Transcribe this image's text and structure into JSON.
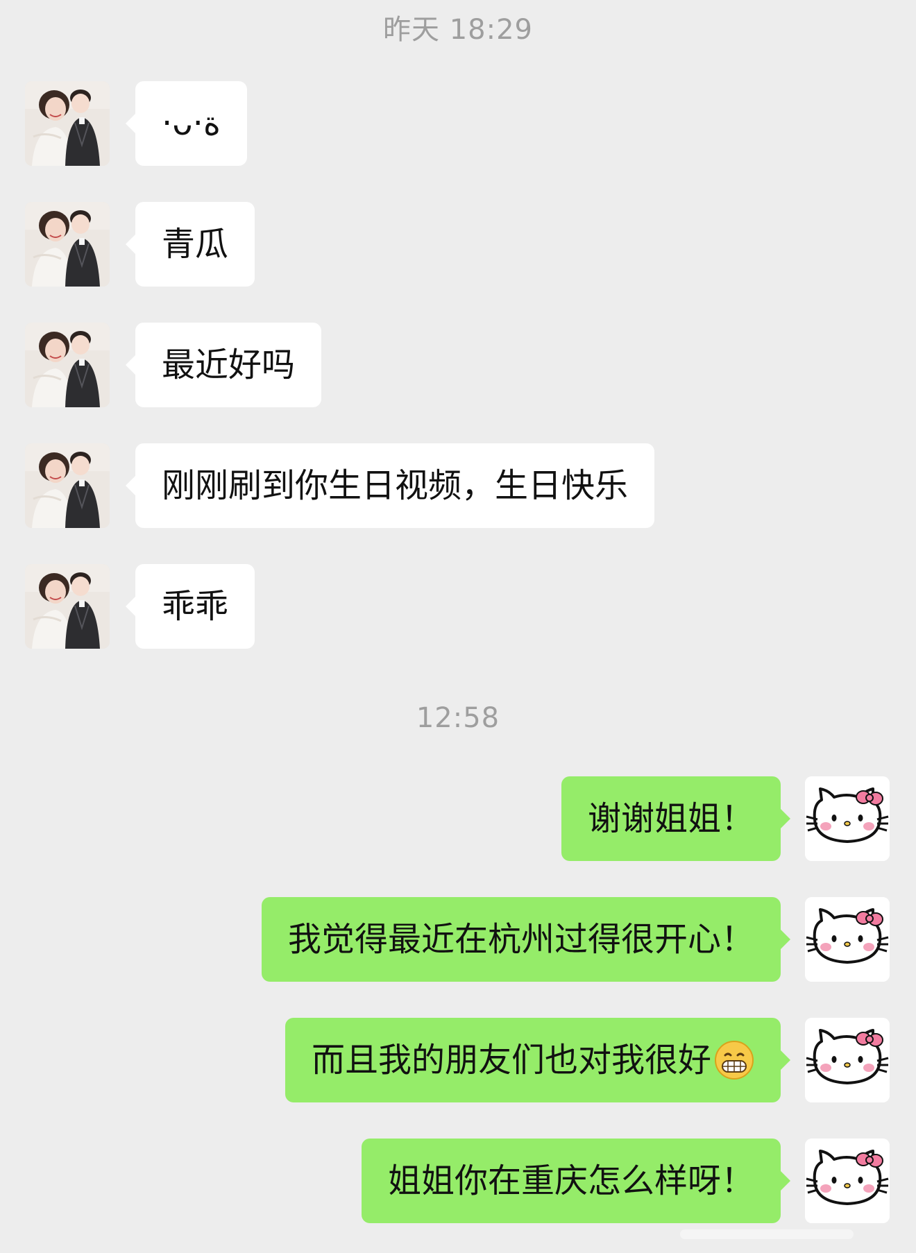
{
  "timestamps": {
    "first": "昨天 18:29",
    "second": "12:58"
  },
  "incoming": [
    {
      "text": "·ᴗ·ة"
    },
    {
      "text": "青瓜"
    },
    {
      "text": "最近好吗"
    },
    {
      "text": "刚刚刷到你生日视频，生日快乐"
    },
    {
      "text": "乖乖"
    }
  ],
  "outgoing": [
    {
      "text": "谢谢姐姐！"
    },
    {
      "text": "我觉得最近在杭州过得很开心！"
    },
    {
      "text": "而且我的朋友们也对我很好",
      "emoji": "grinning-face-emoji"
    },
    {
      "text": "姐姐你在重庆怎么样呀！"
    }
  ],
  "avatars": {
    "contact": "mother-and-child-photo-avatar",
    "self": "hello-kitty-avatar"
  },
  "colors": {
    "background": "#ededed",
    "incoming_bubble": "#ffffff",
    "outgoing_bubble": "#95ec69",
    "timestamp": "#9e9e9e"
  }
}
